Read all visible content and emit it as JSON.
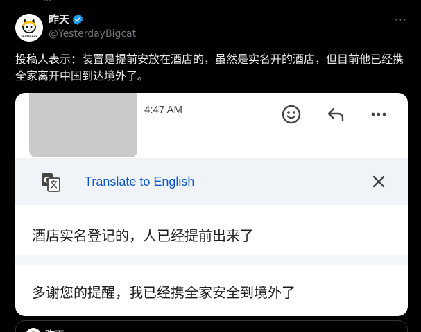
{
  "top_fragment": "…",
  "author": {
    "name": "昨天",
    "handle": "@YesterdayBigcat",
    "avatar_text": "YESTERDAY",
    "verified_color": "#1d9bf0"
  },
  "tweet": {
    "text": "投稿人表示：装置是提前安放在酒店的，虽然是实名开的酒店，但目前他已经携全家离开中国到达境外了。"
  },
  "card": {
    "time": "4:47 AM",
    "translate_label": "Translate to English",
    "messages": [
      "酒店实名登记的，人已经提前出来了",
      "多谢您的提醒，我已经携全家安全到境外了"
    ],
    "accent_color": "#0b57d0"
  },
  "quote": {
    "name": "昨天"
  },
  "colors": {
    "background": "#000000",
    "text_primary": "#e7e9ea",
    "text_secondary": "#71767b"
  }
}
